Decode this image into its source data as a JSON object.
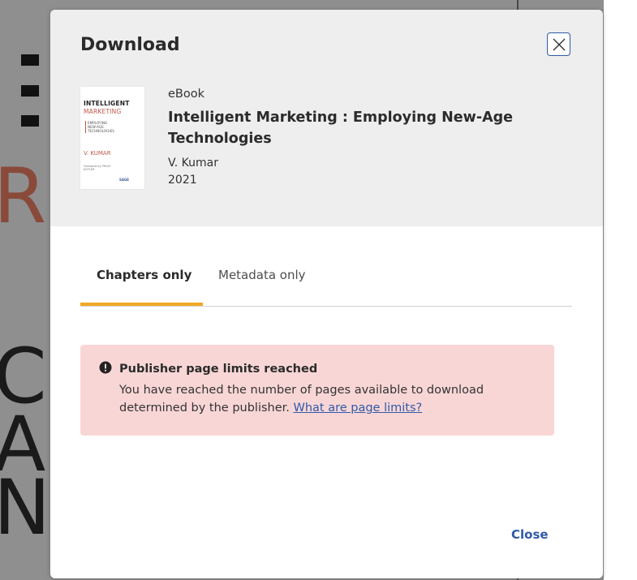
{
  "background": {
    "letters": [
      "E",
      "R",
      "C",
      "A",
      "N"
    ]
  },
  "dialog": {
    "title": "Download",
    "close_icon": "close-icon"
  },
  "book": {
    "type": "eBook",
    "title": "Intelligent Marketing : Employing New-Age Technologies",
    "author": "V. Kumar",
    "year": "2021",
    "cover": {
      "title_line1": "INTELLIGENT",
      "title_line2": "MARKETING",
      "subtitle": "EMPLOYING NEW-AGE TECHNOLOGIES",
      "author": "V. KUMAR",
      "foreword": "Foreword by PHILIP KOTLER",
      "publisher": "SAGE"
    }
  },
  "tabs": [
    {
      "label": "Chapters only",
      "active": true
    },
    {
      "label": "Metadata only",
      "active": false
    }
  ],
  "alert": {
    "icon": "exclamation-circle-icon",
    "title": "Publisher page limits reached",
    "body": "You have reached the number of pages available to download determined by the publisher.",
    "link": "What are page limits?"
  },
  "footer": {
    "close_label": "Close"
  },
  "colors": {
    "accent": "#2f5aa8",
    "tab_active": "#f0a824",
    "alert_bg": "#f9d6d6"
  }
}
